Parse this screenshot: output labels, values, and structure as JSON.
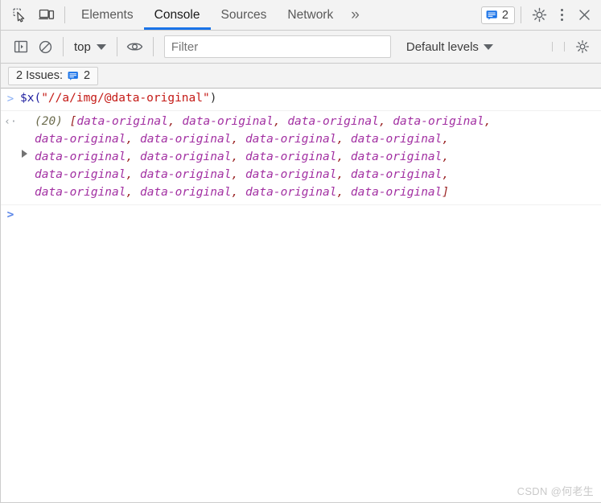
{
  "tabbar": {
    "inspect_icon": "inspect-element-icon",
    "device_icon": "device-toolbar-icon",
    "tabs": [
      {
        "label": "Elements",
        "active": false
      },
      {
        "label": "Console",
        "active": true
      },
      {
        "label": "Sources",
        "active": false
      },
      {
        "label": "Network",
        "active": false
      }
    ],
    "more_tabs_label": "»",
    "issues_count": "2",
    "settings_icon": "gear-icon",
    "more_options_icon": "kebab-menu-icon",
    "close_icon": "close-icon"
  },
  "console_toolbar": {
    "sidebar_icon": "show-console-sidebar-icon",
    "clear_icon": "clear-console-icon",
    "context_label": "top",
    "eye_icon": "live-expression-icon",
    "filter_placeholder": "Filter",
    "filter_value": "",
    "levels_label": "Default levels",
    "settings_icon": "console-settings-gear-icon"
  },
  "issues_bar": {
    "label": "2 Issues:",
    "count": "2",
    "icon": "issues-message-icon"
  },
  "console": {
    "command_prompt": ">",
    "command": {
      "fn": "$x(",
      "string": "\"//a/img/@data-original\"",
      "close": ")"
    },
    "result_prompt": "‹·",
    "result": {
      "length_label": "(20)",
      "open_bracket": "[",
      "close_bracket": "]",
      "item_label": "data-original",
      "separator": ", ",
      "item_count": 20,
      "lines": [
        [
          "data-original",
          "data-original",
          "data-original",
          "data-original"
        ],
        [
          "data-original",
          "data-original",
          "data-original",
          "data-original"
        ],
        [
          "data-original",
          "data-original",
          "data-original",
          "data-original"
        ],
        [
          "data-original",
          "data-original",
          "data-original",
          "data-original"
        ],
        [
          "data-original",
          "data-original",
          "data-original",
          "data-original"
        ]
      ]
    },
    "input_prompt": ">",
    "input_value": ""
  },
  "watermark": {
    "text": "CSDN @何老生"
  },
  "colors": {
    "accent": "#1a73e8",
    "toolbar_bg": "#f3f3f3",
    "string_red": "#c41a16",
    "function_blue": "#1d1d9e",
    "array_purple": "#a230a2",
    "bracket_maroon": "#9b2424",
    "length_olive": "#6b6b4d"
  }
}
